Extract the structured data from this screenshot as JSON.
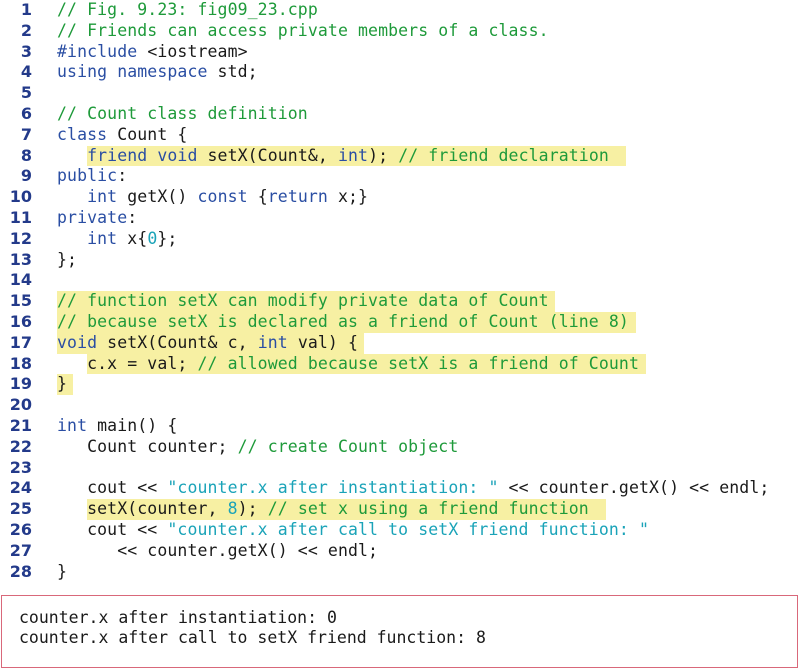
{
  "colors": {
    "line_number": "#233a8a",
    "comment": "#1e9a3a",
    "keyword": "#2a4ea3",
    "string_literal": "#1aa3b8",
    "highlight": "#f7f0a3",
    "output_border": "#d9687a"
  },
  "code_lines": [
    {
      "number": "1",
      "highlight": false,
      "tokens": [
        {
          "type": "comment",
          "text": "// Fig. 9.23: fig09_23.cpp"
        }
      ]
    },
    {
      "number": "2",
      "highlight": false,
      "tokens": [
        {
          "type": "comment",
          "text": "// Friends can access private members of a class."
        }
      ]
    },
    {
      "number": "3",
      "highlight": false,
      "tokens": [
        {
          "type": "keyword",
          "text": "#include"
        },
        {
          "type": "plain",
          "text": " <iostream>"
        }
      ]
    },
    {
      "number": "4",
      "highlight": false,
      "tokens": [
        {
          "type": "keyword",
          "text": "using namespace"
        },
        {
          "type": "plain",
          "text": " std;"
        }
      ]
    },
    {
      "number": "5",
      "highlight": false,
      "tokens": []
    },
    {
      "number": "6",
      "highlight": false,
      "tokens": [
        {
          "type": "comment",
          "text": "// Count class definition"
        }
      ]
    },
    {
      "number": "7",
      "highlight": false,
      "tokens": [
        {
          "type": "keyword",
          "text": "class"
        },
        {
          "type": "plain",
          "text": " Count {"
        }
      ]
    },
    {
      "number": "8",
      "highlight": true,
      "tokens": [
        {
          "type": "plain",
          "text": "   "
        },
        {
          "type": "keyword",
          "text": "friend void"
        },
        {
          "type": "plain",
          "text": " setX(Count&, "
        },
        {
          "type": "keyword",
          "text": "int"
        },
        {
          "type": "plain",
          "text": "); "
        },
        {
          "type": "comment",
          "text": "// friend declaration "
        }
      ]
    },
    {
      "number": "9",
      "highlight": false,
      "tokens": [
        {
          "type": "keyword",
          "text": "public"
        },
        {
          "type": "plain",
          "text": ":"
        }
      ]
    },
    {
      "number": "10",
      "highlight": false,
      "tokens": [
        {
          "type": "plain",
          "text": "   "
        },
        {
          "type": "keyword",
          "text": "int"
        },
        {
          "type": "plain",
          "text": " getX() "
        },
        {
          "type": "keyword",
          "text": "const"
        },
        {
          "type": "plain",
          "text": " {"
        },
        {
          "type": "keyword",
          "text": "return"
        },
        {
          "type": "plain",
          "text": " x;}"
        }
      ]
    },
    {
      "number": "11",
      "highlight": false,
      "tokens": [
        {
          "type": "keyword",
          "text": "private"
        },
        {
          "type": "plain",
          "text": ":"
        }
      ]
    },
    {
      "number": "12",
      "highlight": false,
      "tokens": [
        {
          "type": "plain",
          "text": "   "
        },
        {
          "type": "keyword",
          "text": "int"
        },
        {
          "type": "plain",
          "text": " x{"
        },
        {
          "type": "number",
          "text": "0"
        },
        {
          "type": "plain",
          "text": "};"
        }
      ]
    },
    {
      "number": "13",
      "highlight": false,
      "tokens": [
        {
          "type": "plain",
          "text": "};"
        }
      ]
    },
    {
      "number": "14",
      "highlight": false,
      "tokens": []
    },
    {
      "number": "15",
      "highlight": true,
      "tokens": [
        {
          "type": "comment",
          "text": "// function setX can modify private data of Count"
        }
      ]
    },
    {
      "number": "16",
      "highlight": true,
      "tokens": [
        {
          "type": "comment",
          "text": "// because setX is declared as a friend of Count (line 8)"
        }
      ]
    },
    {
      "number": "17",
      "highlight": true,
      "tokens": [
        {
          "type": "keyword",
          "text": "void"
        },
        {
          "type": "plain",
          "text": " setX(Count& c, "
        },
        {
          "type": "keyword",
          "text": "int"
        },
        {
          "type": "plain",
          "text": " val) {"
        }
      ]
    },
    {
      "number": "18",
      "highlight": true,
      "tokens": [
        {
          "type": "plain",
          "text": "   c.x = val; "
        },
        {
          "type": "comment",
          "text": "// allowed because setX is a friend of Count"
        }
      ]
    },
    {
      "number": "19",
      "highlight": true,
      "tokens": [
        {
          "type": "plain",
          "text": "}"
        }
      ]
    },
    {
      "number": "20",
      "highlight": false,
      "tokens": []
    },
    {
      "number": "21",
      "highlight": false,
      "tokens": [
        {
          "type": "keyword",
          "text": "int"
        },
        {
          "type": "plain",
          "text": " main() {"
        }
      ]
    },
    {
      "number": "22",
      "highlight": false,
      "tokens": [
        {
          "type": "plain",
          "text": "   Count counter; "
        },
        {
          "type": "comment",
          "text": "// create Count object"
        }
      ]
    },
    {
      "number": "23",
      "highlight": false,
      "tokens": []
    },
    {
      "number": "24",
      "highlight": false,
      "tokens": [
        {
          "type": "plain",
          "text": "   cout << "
        },
        {
          "type": "string",
          "text": "\"counter.x after instantiation: \""
        },
        {
          "type": "plain",
          "text": " << counter.getX() << endl;"
        }
      ]
    },
    {
      "number": "25",
      "highlight": true,
      "tokens": [
        {
          "type": "plain",
          "text": "   setX(counter, "
        },
        {
          "type": "number",
          "text": "8"
        },
        {
          "type": "plain",
          "text": "); "
        },
        {
          "type": "comment",
          "text": "// set x using a friend function "
        }
      ]
    },
    {
      "number": "26",
      "highlight": false,
      "tokens": [
        {
          "type": "plain",
          "text": "   cout << "
        },
        {
          "type": "string",
          "text": "\"counter.x after call to setX friend function: \""
        }
      ]
    },
    {
      "number": "27",
      "highlight": false,
      "tokens": [
        {
          "type": "plain",
          "text": "      << counter.getX() << endl;"
        }
      ]
    },
    {
      "number": "28",
      "highlight": false,
      "tokens": [
        {
          "type": "plain",
          "text": "}"
        }
      ]
    }
  ],
  "output": {
    "lines": [
      "counter.x after instantiation: 0",
      "counter.x after call to setX friend function: 8"
    ]
  }
}
